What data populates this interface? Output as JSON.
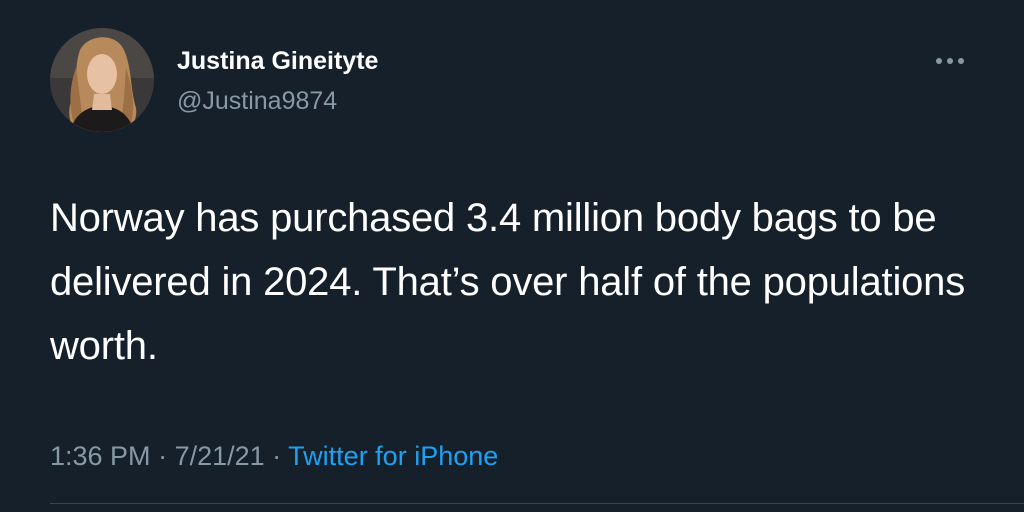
{
  "user": {
    "name": "Justina Gineityte",
    "handle": "@Justina9874"
  },
  "tweet": {
    "text": "Norway has purchased 3.4 million body bags to be delivered in 2024. That’s over half of the populations worth.",
    "time": "1:36 PM",
    "separator_1": " · ",
    "date": "7/21/21",
    "separator_2": " · ",
    "source": "Twitter for iPhone"
  },
  "icons": {
    "more": "more-options-icon"
  },
  "colors": {
    "background": "#15202b",
    "primary_text": "#ffffff",
    "secondary_text": "#8899a6",
    "link": "#1da1f2",
    "divider": "#38444d"
  }
}
